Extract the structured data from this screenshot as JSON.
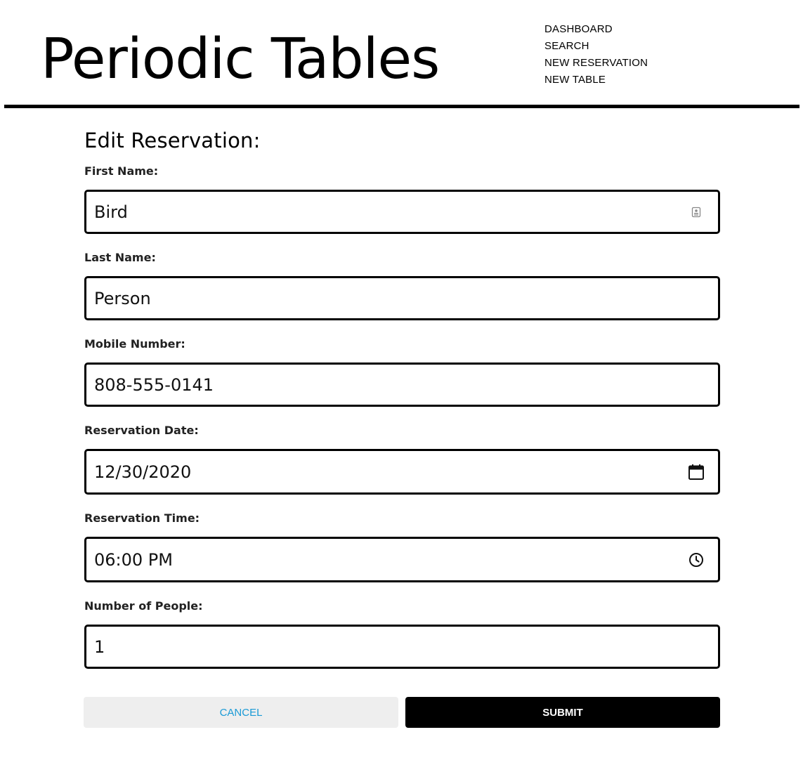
{
  "header": {
    "brand": "Periodic Tables",
    "nav": [
      {
        "label": "DASHBOARD"
      },
      {
        "label": "SEARCH"
      },
      {
        "label": "NEW RESERVATION"
      },
      {
        "label": "NEW TABLE"
      }
    ]
  },
  "form": {
    "title": "Edit Reservation:",
    "fields": {
      "first_name": {
        "label": "First Name:",
        "value": "Bird",
        "icon": "contact-card-icon"
      },
      "last_name": {
        "label": "Last Name:",
        "value": "Person"
      },
      "mobile_number": {
        "label": "Mobile Number:",
        "value": "808-555-0141"
      },
      "reservation_date": {
        "label": "Reservation Date:",
        "value": "12/30/2020",
        "icon": "calendar-icon"
      },
      "reservation_time": {
        "label": "Reservation Time:",
        "value": "06:00 PM",
        "icon": "clock-icon"
      },
      "people": {
        "label": "Number of People:",
        "value": "1"
      }
    },
    "buttons": {
      "cancel": "CANCEL",
      "submit": "SUBMIT"
    }
  },
  "colors": {
    "cancel_text": "#1a9ad6",
    "cancel_bg": "#eeeeee",
    "submit_bg": "#000000",
    "submit_text": "#ffffff"
  }
}
